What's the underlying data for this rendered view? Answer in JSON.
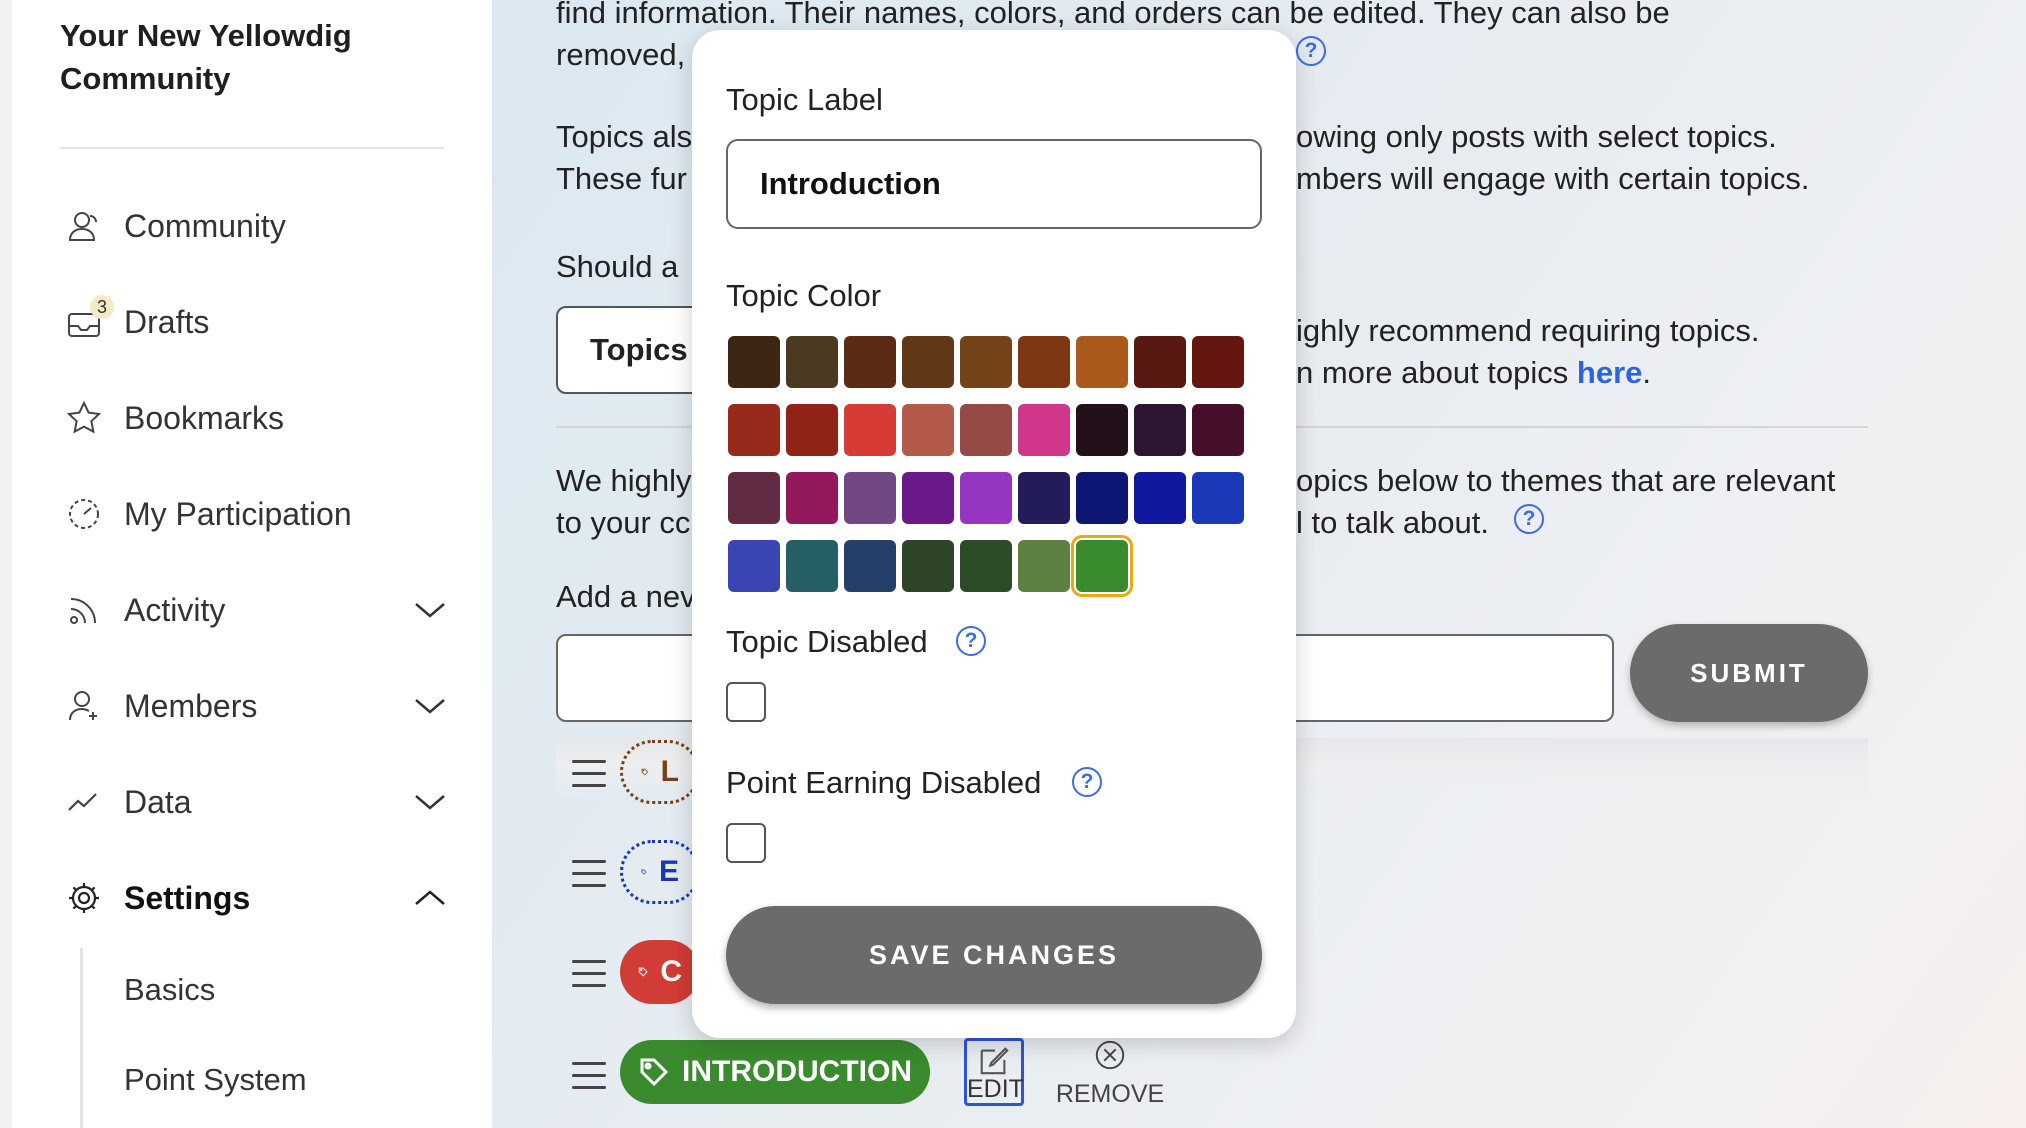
{
  "sidebar": {
    "community_title": "Your New Yellowdig Community",
    "items": [
      {
        "label": "Community"
      },
      {
        "label": "Drafts",
        "badge": "3"
      },
      {
        "label": "Bookmarks"
      },
      {
        "label": "My Participation"
      },
      {
        "label": "Activity"
      },
      {
        "label": "Members"
      },
      {
        "label": "Data"
      },
      {
        "label": "Settings"
      }
    ],
    "settings_subitems": [
      "Basics",
      "Point System"
    ]
  },
  "main": {
    "para1_line1": "find information. Their names, colors, and orders can be edited. They can also be",
    "para1_line2": "removed,",
    "para2_line1_left": "Topics als",
    "para2_line1_right": "owing only posts with select topics.",
    "para2_line2_left": "These fur",
    "para2_line2_right": "mbers will engage with certain topics.",
    "question_left": "Should a",
    "select_value": "Topics",
    "recommend_line1": "ighly recommend requiring topics.",
    "recommend_line2_pre": "n more about topics ",
    "recommend_link": "here",
    "recommend_line2_post": ".",
    "para3_line1_left": "We highly",
    "para3_line1_right": "opics below to themes that are relevant",
    "para3_line2_left": "to your cc",
    "para3_line2_right": "l to talk about.",
    "add_label": "Add a nev",
    "help_glyph": "?",
    "submit_label": "SUBMIT",
    "topics": [
      {
        "label": "L",
        "color": "#7a3f12",
        "style": "dotted"
      },
      {
        "label": "E",
        "color": "#1a37b8",
        "style": "dotted"
      },
      {
        "label": "C",
        "color": "#d23c36",
        "style": "solid"
      },
      {
        "label": "INTRODUCTION",
        "color": "#3a8a2e",
        "style": "solid"
      }
    ],
    "edit_label": "EDIT",
    "remove_label": "REMOVE"
  },
  "modal": {
    "topic_label_title": "Topic Label",
    "topic_label_value": "Introduction",
    "topic_color_title": "Topic Color",
    "colors": [
      "#3e2614",
      "#4b3922",
      "#5c2b16",
      "#613718",
      "#75431a",
      "#7d3712",
      "#ab5a1e",
      "#571911",
      "#661610",
      "#982a1c",
      "#902216",
      "#d63b35",
      "#b35a4a",
      "#964a45",
      "#d0378b",
      "#23101a",
      "#2c1732",
      "#470e2a",
      "#612c43",
      "#93195c",
      "#714883",
      "#6b1889",
      "#9535c0",
      "#221c5b",
      "#0e1674",
      "#10199e",
      "#1a38b8",
      "#3a44b3",
      "#265f63",
      "#243f6a",
      "#2f4528",
      "#2b4c26",
      "#5e8142",
      "#3a8a2e"
    ],
    "selected_color": "#3a8a2e",
    "topic_disabled_label": "Topic Disabled",
    "point_earning_disabled_label": "Point Earning Disabled",
    "save_label": "SAVE CHANGES"
  }
}
